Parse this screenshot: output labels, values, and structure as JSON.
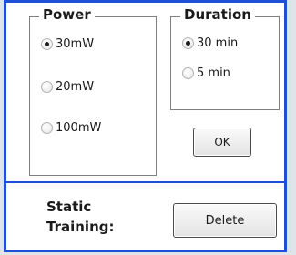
{
  "power": {
    "title": "Power",
    "options": [
      {
        "label": "30mW",
        "selected": true
      },
      {
        "label": "20mW",
        "selected": false
      },
      {
        "label": "100mW",
        "selected": false
      }
    ]
  },
  "duration": {
    "title": "Duration",
    "options": [
      {
        "label": "30 min",
        "selected": true
      },
      {
        "label": "5 min",
        "selected": false
      }
    ]
  },
  "buttons": {
    "ok_label": "OK",
    "delete_label": "Delete"
  },
  "static_training": {
    "label": "Static\nTraining:"
  },
  "colors": {
    "frame_border": "#1e4fd6",
    "background": "#ffffff"
  }
}
